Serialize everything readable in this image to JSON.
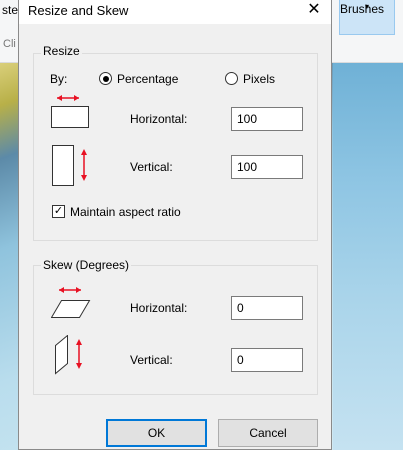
{
  "background": {
    "left_tab_top": "ste",
    "left_tab_bottom": "Cli",
    "brushes_button": {
      "label": "Brushes",
      "caret": "▾"
    }
  },
  "dialog": {
    "title": "Resize and Skew",
    "close_glyph": "✕",
    "resize": {
      "legend": "Resize",
      "by_label": "By:",
      "options": [
        {
          "label": "Percentage",
          "selected": true
        },
        {
          "label": "Pixels",
          "selected": false
        }
      ],
      "horizontal_label": "Horizontal:",
      "horizontal_value": "100",
      "vertical_label": "Vertical:",
      "vertical_value": "100",
      "maintain_aspect_label": "Maintain aspect ratio",
      "maintain_aspect_checked": true
    },
    "skew": {
      "legend": "Skew (Degrees)",
      "horizontal_label": "Horizontal:",
      "horizontal_value": "0",
      "vertical_label": "Vertical:",
      "vertical_value": "0"
    },
    "buttons": {
      "ok": "OK",
      "cancel": "Cancel"
    }
  },
  "colors": {
    "arrow_red": "#e81123",
    "focus_blue": "#0078d7"
  }
}
